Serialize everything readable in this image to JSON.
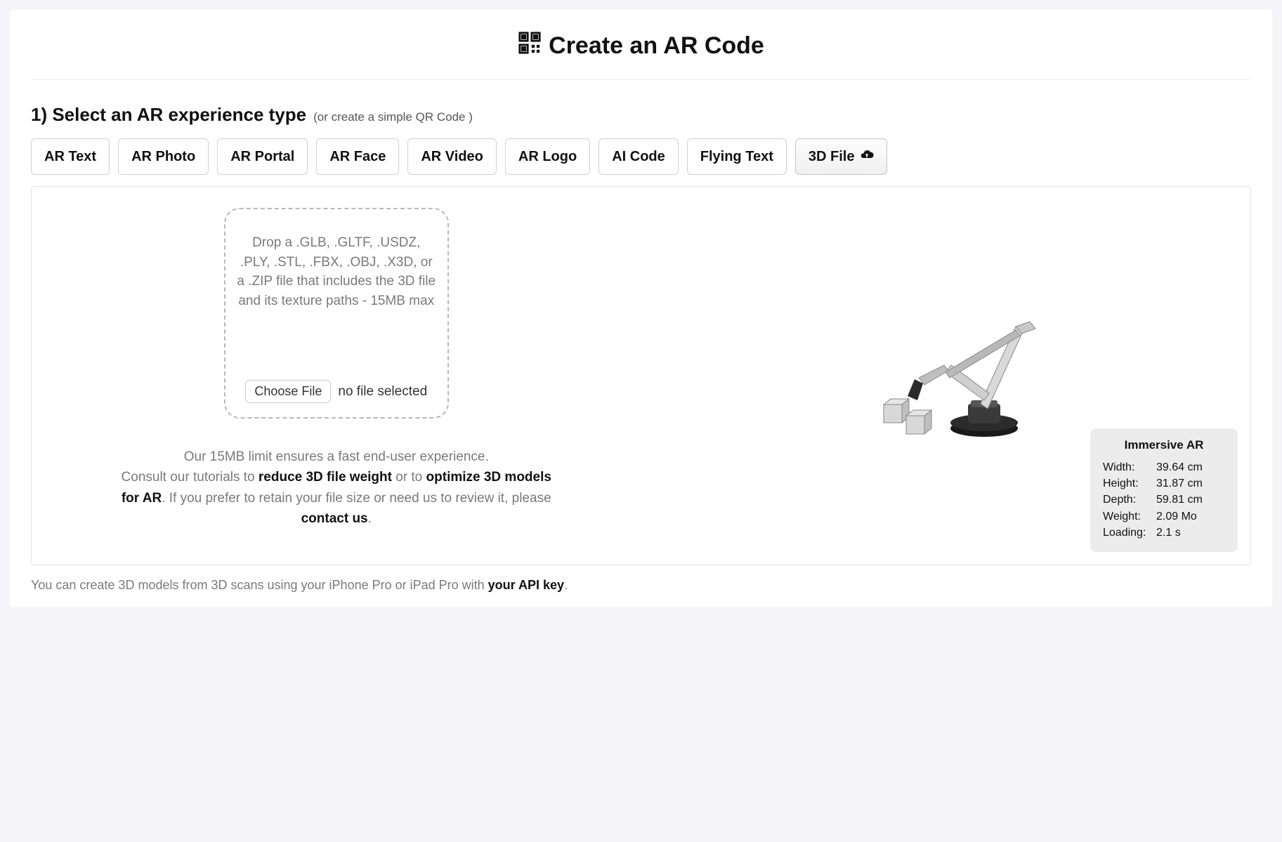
{
  "header": {
    "title": "Create an AR Code"
  },
  "step": {
    "heading": "1) Select an AR experience type",
    "hint_prefix": "(or create a simple ",
    "hint_link": "QR Code",
    "hint_suffix": " )"
  },
  "tabs": {
    "ar_text": "AR Text",
    "ar_photo": "AR Photo",
    "ar_portal": "AR Portal",
    "ar_face": "AR Face",
    "ar_video": "AR Video",
    "ar_logo": "AR Logo",
    "ai_code": "AI Code",
    "flying_text": "Flying Text",
    "three_d_file": "3D File"
  },
  "dropzone": {
    "text": "Drop a .GLB, .GLTF, .USDZ, .PLY, .STL, .FBX, .OBJ, .X3D, or a .ZIP file that includes the 3D file and its texture paths - 15MB max",
    "choose_file_label": "Choose File",
    "file_status": "no file selected"
  },
  "help": {
    "line1": "Our 15MB limit ensures a fast end-user experience.",
    "line2_prefix": "Consult our tutorials to ",
    "reduce_link": "reduce 3D file weight",
    "line2_mid": " or to ",
    "optimize_link": "optimize 3D models for AR",
    "line3_prefix": ". If you prefer to retain your file size or need us to review it, please ",
    "contact_link": "contact us",
    "line3_suffix": "."
  },
  "preview": {
    "title": "Immersive AR",
    "width_label": "Width:",
    "width_value": "39.64 cm",
    "height_label": "Height:",
    "height_value": "31.87 cm",
    "depth_label": "Depth:",
    "depth_value": "59.81 cm",
    "weight_label": "Weight:",
    "weight_value": "2.09 Mo",
    "loading_label": "Loading:",
    "loading_value": "2.1 s"
  },
  "footnote": {
    "prefix": "You can create 3D models from 3D scans using your iPhone Pro or iPad Pro with ",
    "link": "your API key",
    "suffix": "."
  }
}
